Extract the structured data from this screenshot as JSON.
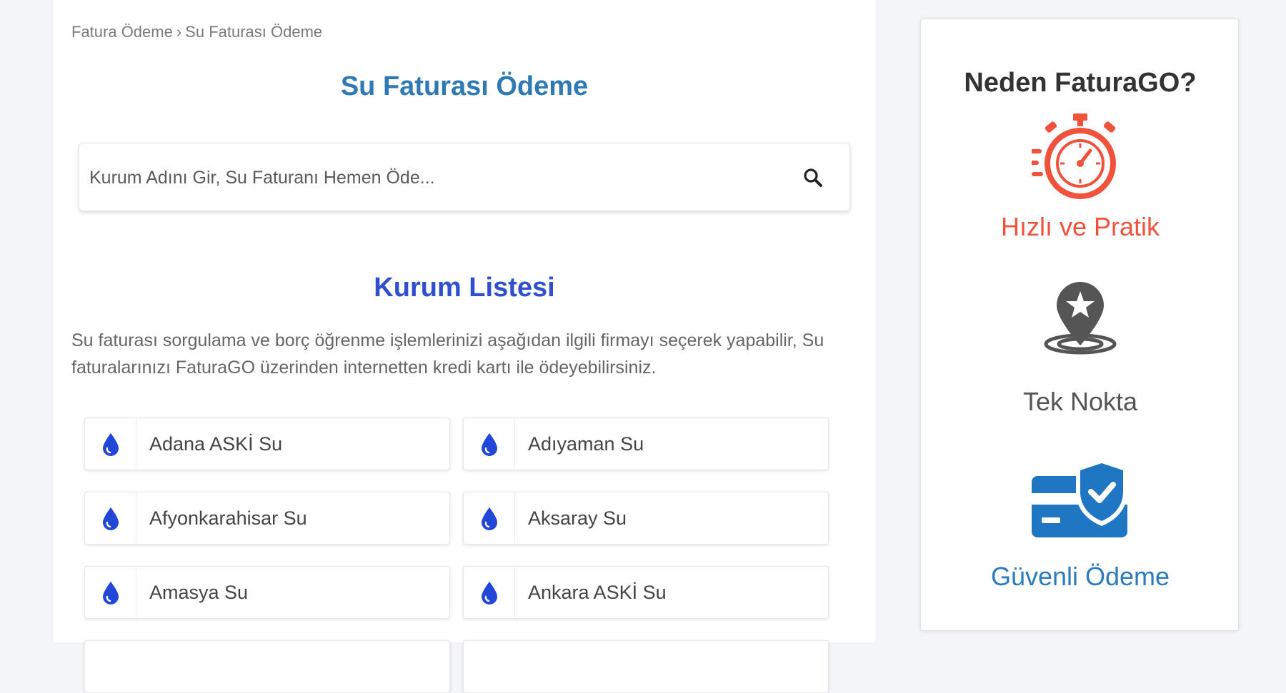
{
  "breadcrumb": {
    "items": [
      "Fatura Ödeme",
      "Su Faturası Ödeme"
    ],
    "separator": "›"
  },
  "page_title": "Su Faturası Ödeme",
  "search": {
    "placeholder": "Kurum Adını Gir, Su Faturanı Hemen Öde...",
    "value": ""
  },
  "institutions": {
    "title": "Kurum Listesi",
    "description": "Su faturası sorgulama ve borç öğrenme işlemlerinizi aşağıdan ilgili firmayı seçerek yapabilir, Su faturalarınızı FaturaGO üzerinden internetten kredi kartı ile ödeyebilirsiniz.",
    "items": [
      {
        "label": "Adana ASKİ Su",
        "icon": "water-drop-icon"
      },
      {
        "label": "Adıyaman Su",
        "icon": "water-drop-icon"
      },
      {
        "label": "Afyonkarahisar Su",
        "icon": "water-drop-icon"
      },
      {
        "label": "Aksaray Su",
        "icon": "water-drop-icon"
      },
      {
        "label": "Amasya Su",
        "icon": "water-drop-icon"
      },
      {
        "label": "Ankara ASKİ Su",
        "icon": "water-drop-icon"
      }
    ]
  },
  "sidebar": {
    "title": "Neden FaturaGO?",
    "features": [
      {
        "label": "Hızlı ve Pratik",
        "icon": "stopwatch-icon",
        "color": "#f0523c"
      },
      {
        "label": "Tek Nokta",
        "icon": "location-star-icon",
        "color": "#555555"
      },
      {
        "label": "Güvenli Ödeme",
        "icon": "secure-card-icon",
        "color": "#2a7bbf"
      }
    ]
  },
  "colors": {
    "title_blue": "#2f7ab5",
    "list_title_blue": "#2f4fd0",
    "drop_blue": "#2146d8",
    "accent_red": "#f0523c",
    "secure_blue": "#1f77c3"
  }
}
